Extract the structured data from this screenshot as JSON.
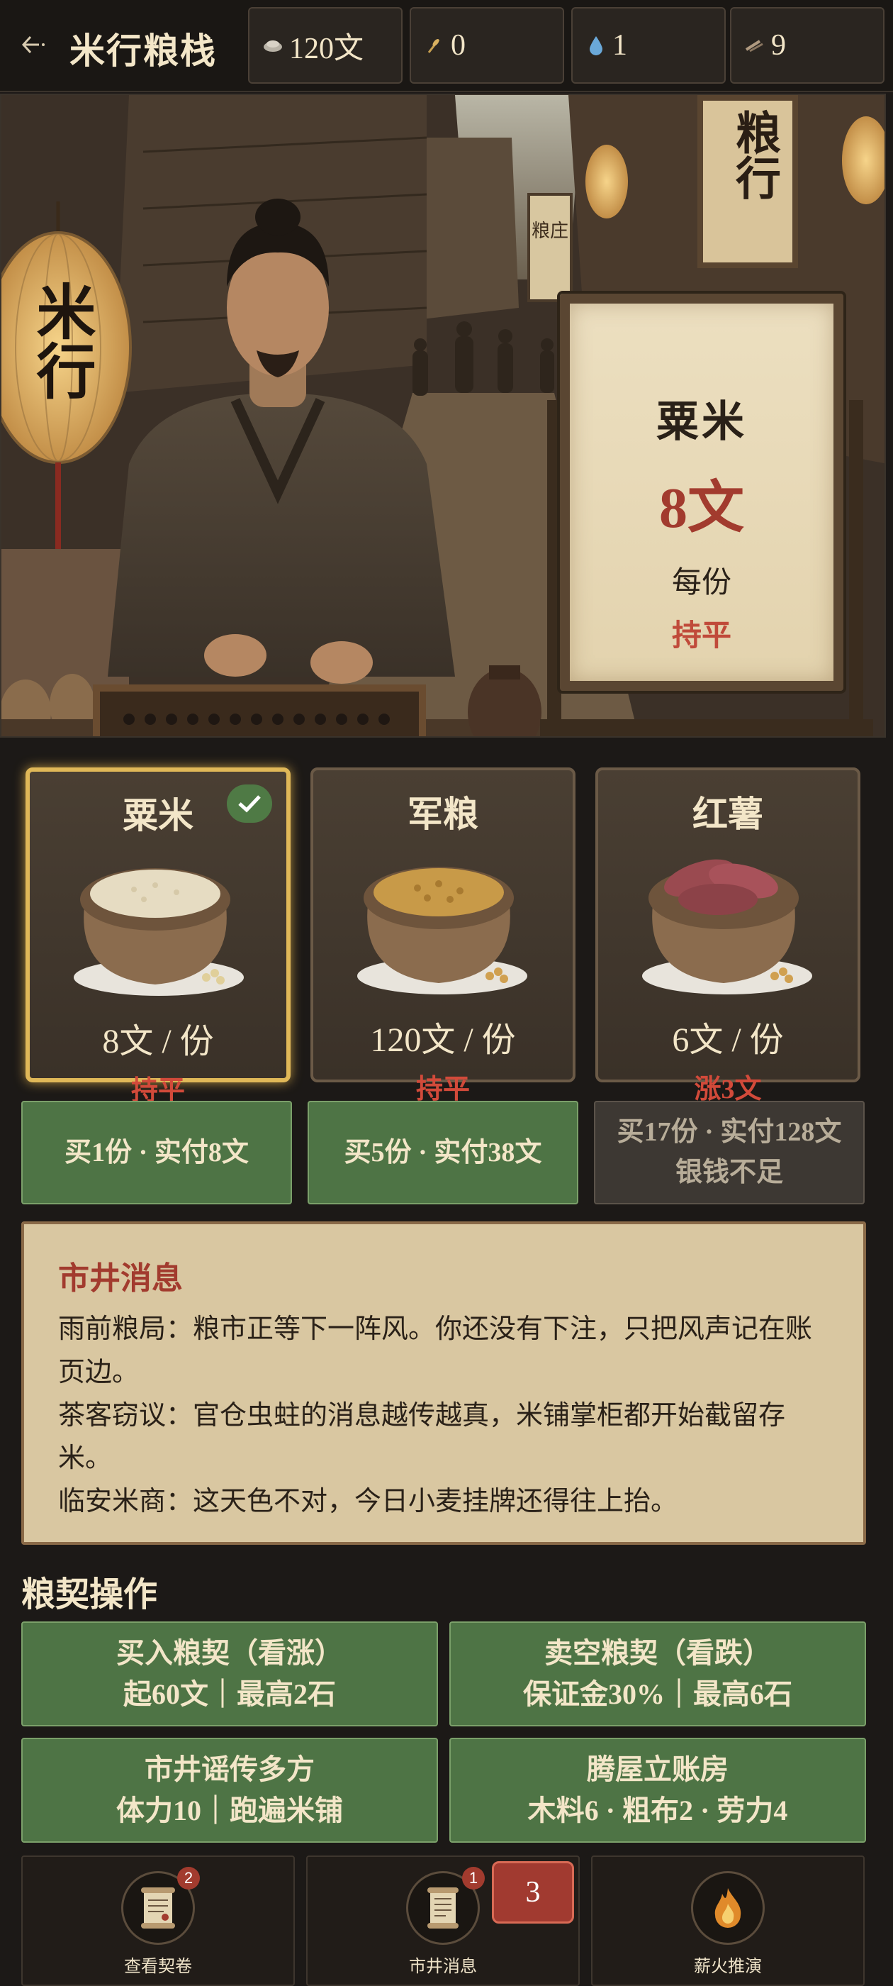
{
  "header": {
    "title": "米行粮栈",
    "resources": [
      {
        "icon": "silver-icon",
        "value": "120文"
      },
      {
        "icon": "grain-icon",
        "value": "0"
      },
      {
        "icon": "water-icon",
        "value": "1"
      },
      {
        "icon": "wood-icon",
        "value": "9"
      }
    ]
  },
  "hero": {
    "lantern_text": "米行",
    "sign_text": "粮行",
    "small_sign_text": "粮庄",
    "board": {
      "name": "粟米",
      "price": "8文",
      "unit": "每份",
      "trend": "持平"
    }
  },
  "goods": [
    {
      "name": "粟米",
      "price": "8文 / 份",
      "trend": "持平",
      "selected": true,
      "icon": "millet-sack-icon"
    },
    {
      "name": "军粮",
      "price": "120文 / 份",
      "trend": "持平",
      "selected": false,
      "icon": "wheat-sack-icon"
    },
    {
      "name": "红薯",
      "price": "6文 / 份",
      "trend": "涨3文",
      "selected": false,
      "icon": "sweet-potato-sack-icon"
    }
  ],
  "buy_buttons": [
    {
      "label": "买1份 · 实付8文",
      "enabled": true
    },
    {
      "label": "买5份 · 实付38文",
      "enabled": true
    },
    {
      "label": "买17份 · 实付128文",
      "sub": "银钱不足",
      "enabled": false
    }
  ],
  "news": {
    "title": "市井消息",
    "items": [
      "雨前粮局：粮市正等下一阵风。你还没有下注，只把风声记在账页边。",
      "茶客窃议：官仓虫蛀的消息越传越真，米铺掌柜都开始截留存米。",
      "临安米商：这天色不对，今日小麦挂牌还得往上抬。"
    ]
  },
  "ops": {
    "title": "粮契操作",
    "buttons": [
      {
        "line1": "买入粮契（看涨）",
        "line2": "起60文｜最高2石"
      },
      {
        "line1": "卖空粮契（看跌）",
        "line2": "保证金30%｜最高6石"
      },
      {
        "line1": "市井谣传多方",
        "line2": "体力10｜跑遍米铺"
      },
      {
        "line1": "腾屋立账房",
        "line2": "木料6 · 粗布2 · 劳力4"
      }
    ]
  },
  "nav": {
    "items": [
      {
        "label": "查看契卷",
        "badge": "2",
        "icon": "scroll-icon"
      },
      {
        "label": "市井消息",
        "badge": "1",
        "icon": "notice-scroll-icon"
      },
      {
        "label": "薪火推演",
        "badge": "",
        "icon": "flame-icon"
      }
    ],
    "float_badge": "3"
  }
}
